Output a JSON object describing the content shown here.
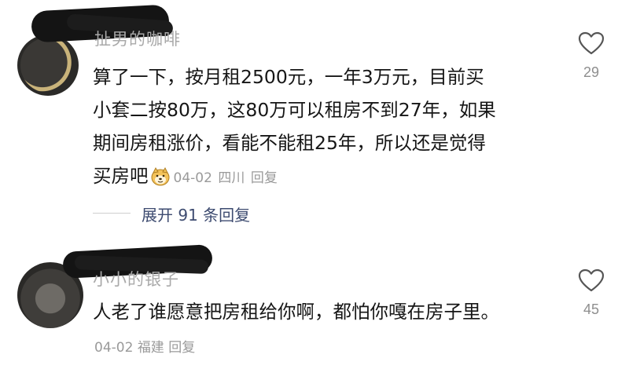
{
  "comments": [
    {
      "username": "扯男的咖啡",
      "lines": [
        "算了一下，按月租2500元，一年3万元，目前买",
        "小套二按80万，这80万可以租房不到27年，如果",
        "期间房租涨价，看能不能租25年，所以还是觉得",
        "买房吧"
      ],
      "emoji": "doge-emoji",
      "date": "04-02",
      "location": "四川",
      "reply_label": "回复",
      "like_count": "29",
      "expand_label": "展开 91 条回复"
    },
    {
      "username": "小小的银子",
      "text": "人老了谁愿意把房租给你啊，都怕你嘎在房子里。",
      "date": "04-02",
      "location": "福建",
      "reply_label": "回复",
      "like_count": "45"
    }
  ],
  "colors": {
    "text": "#161616",
    "meta": "#9a9a9a",
    "link": "#3d4b70",
    "icon": "#555555"
  }
}
